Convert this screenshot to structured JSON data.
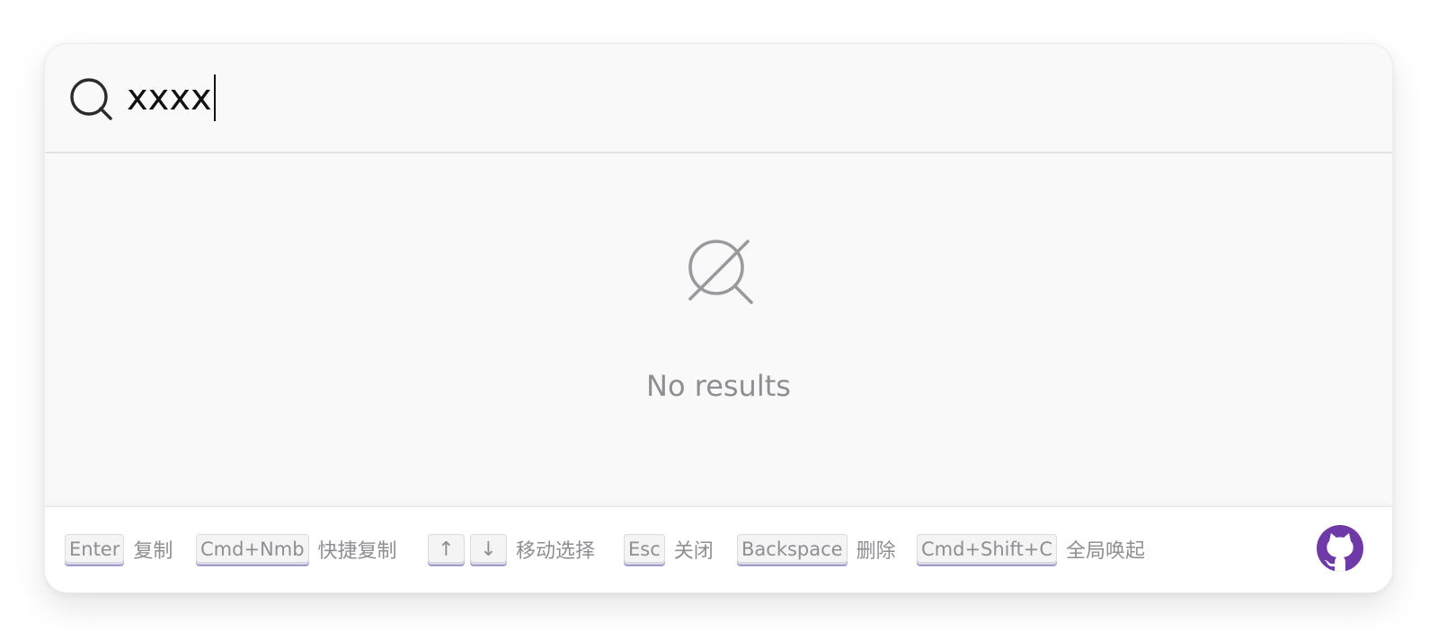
{
  "search": {
    "query": "xxxx"
  },
  "results": {
    "empty_message": "No results"
  },
  "footer": {
    "hints": [
      {
        "keys": [
          "Enter"
        ],
        "label": "复制"
      },
      {
        "keys": [
          "Cmd+Nmb"
        ],
        "label": "快捷复制"
      },
      {
        "keys": [
          "↑",
          "↓"
        ],
        "label": "移动选择"
      },
      {
        "keys": [
          "Esc"
        ],
        "label": "关闭"
      },
      {
        "keys": [
          "Backspace"
        ],
        "label": "删除"
      },
      {
        "keys": [
          "Cmd+Shift+C"
        ],
        "label": "全局唤起"
      }
    ]
  },
  "icons": {
    "search": "search-icon",
    "no_results": "no-results-icon",
    "github": "github-icon"
  },
  "colors": {
    "accent": "#6f3aa8",
    "muted_text": "#8e8e93",
    "key_shadow": "#9b9ccd"
  }
}
